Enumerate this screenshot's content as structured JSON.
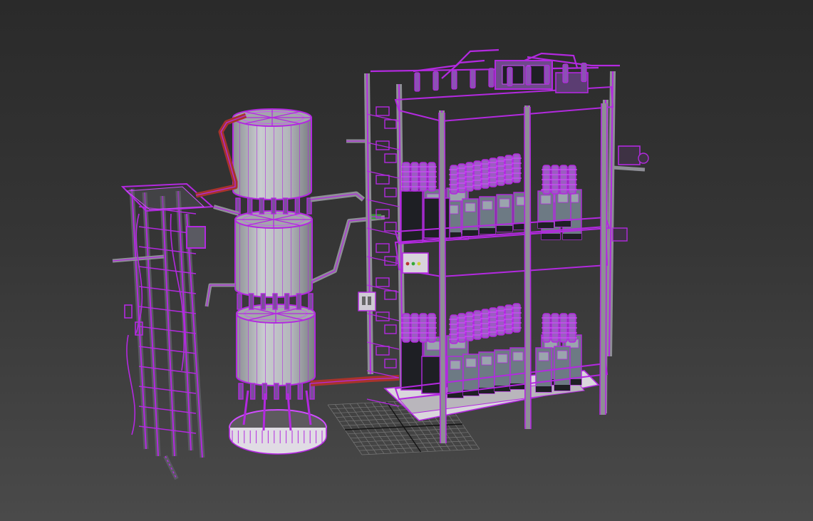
{
  "viewport": {
    "background_top": "#2a2a2a",
    "background_bottom": "#4a4a4a"
  },
  "scene": {
    "wire_color": "#b329e0",
    "wire_highlight": "#d04cff",
    "metal_color": "#8e8e96",
    "metal_dark": "#5a5a62",
    "tank_color": "#b4b7bc",
    "tank_shade": "#7d8085",
    "battery_color": "#6d7a84",
    "battery_dark": "#1e1f24",
    "pipe_red": "#a8332c",
    "pipe_green": "#3c9a3a",
    "grid_color": "#777777",
    "grid_axis": "#111111"
  }
}
